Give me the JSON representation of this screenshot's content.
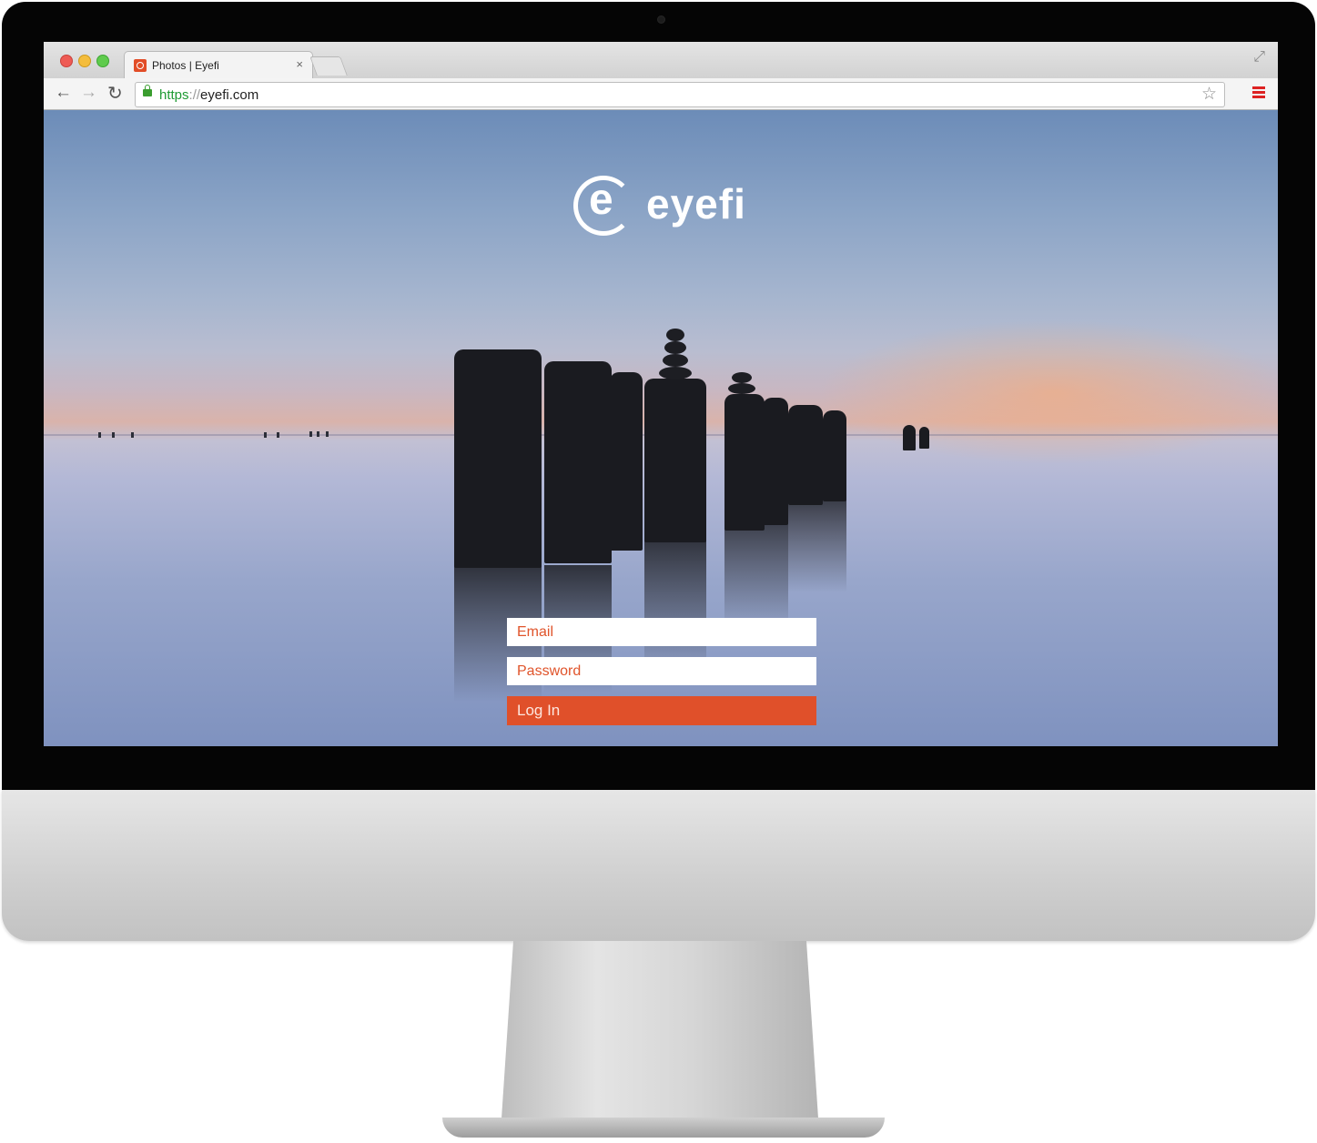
{
  "browser": {
    "tab": {
      "title": "Photos | Eyefi",
      "close_glyph": "×"
    },
    "toolbar": {
      "back_glyph": "←",
      "forward_glyph": "→",
      "reload_glyph": "↻",
      "url_scheme": "https",
      "url_separator": "://",
      "url_host": "eyefi.com",
      "star_glyph": "☆",
      "fullscreen_glyph": "⤢"
    }
  },
  "page": {
    "brand": "eyefi",
    "form": {
      "email_placeholder": "Email",
      "password_placeholder": "Password",
      "login_label": "Log In"
    }
  },
  "colors": {
    "accent": "#e0502a",
    "url_scheme": "#1f9b34",
    "menu_icon": "#dd2222"
  }
}
